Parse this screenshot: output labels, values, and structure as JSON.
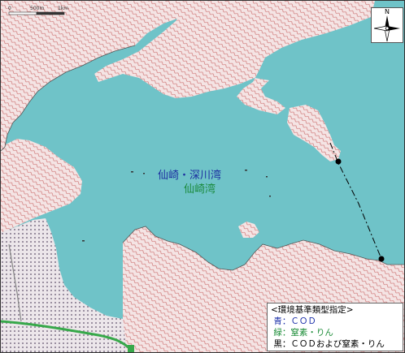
{
  "map": {
    "bay_label_main": "仙崎・深川湾",
    "bay_label_sub": "仙崎湾",
    "compass_label": "N",
    "scale_ticks": [
      "0",
      "500m",
      "1km"
    ],
    "colors": {
      "sea": "#6fc3c8",
      "land": "#f4e4e4",
      "contour": "#d07a7a",
      "blue_text": "#1a2ea8",
      "green_text": "#1f8e3a",
      "road_green": "#37a84a"
    }
  },
  "legend": {
    "title": "<環境基準類型指定>",
    "rows": [
      {
        "key": "青",
        "sep": "：",
        "value": "ＣＯＤ",
        "color_class": "blue"
      },
      {
        "key": "緑",
        "sep": "：",
        "value": "窒素・りん",
        "color_class": "green"
      },
      {
        "key": "黒",
        "sep": "：",
        "value": "ＣＯＤおよび窒素・りん",
        "color_class": "black"
      }
    ]
  }
}
